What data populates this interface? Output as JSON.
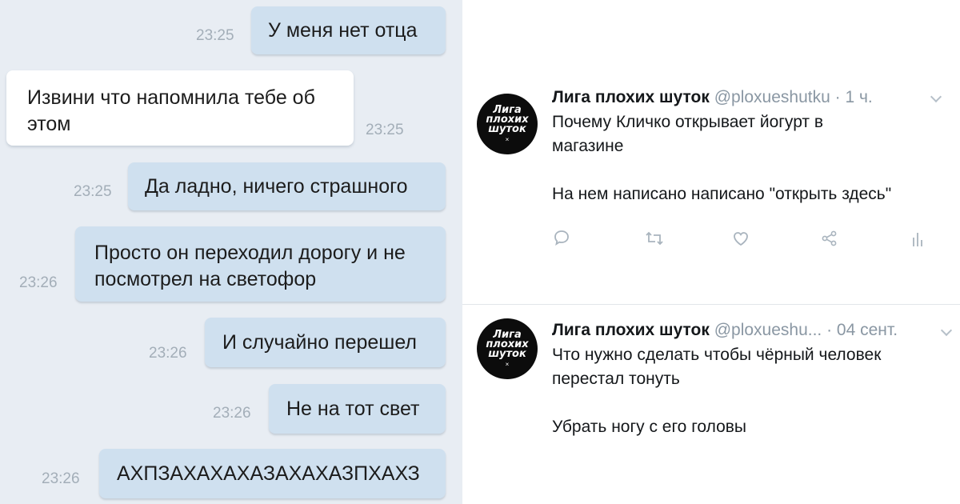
{
  "chat": {
    "messages": [
      {
        "text": "У меня нет отца",
        "time": "23:25",
        "side": "out"
      },
      {
        "line1": "Извини что напомнила тебе об",
        "line2": "этом",
        "time": "23:25",
        "side": "in"
      },
      {
        "text": "Да ладно, ничего страшного",
        "time": "23:25",
        "side": "out"
      },
      {
        "line1": "Просто он переходил дорогу и не",
        "line2": "посмотрел на светофор",
        "time": "23:26",
        "side": "out"
      },
      {
        "text": "И случайно перешел",
        "time": "23:26",
        "side": "out"
      },
      {
        "text": "Не на тот свет",
        "time": "23:26",
        "side": "out"
      },
      {
        "text": "АХПЗАХАХАХАЗАХАХАЗПХАХЗ",
        "time": "23:26",
        "side": "out"
      }
    ]
  },
  "tweets": [
    {
      "avatar_lines": [
        "Лига",
        "плохих",
        "шуток"
      ],
      "avatar_mark": "×",
      "name": "Лига плохих шуток",
      "handle": "@ploxueshutku",
      "time": "· 1 ч.",
      "text": "Почему Кличко открывает йогурт в\nмагазине\n\nНа нем написано написано  \"открыть здесь\"",
      "actions": [
        "reply-icon",
        "retweet-icon",
        "like-icon",
        "share-icon",
        "analytics-icon"
      ]
    },
    {
      "avatar_lines": [
        "Лига",
        "плохих",
        "шуток"
      ],
      "avatar_mark": "×",
      "name": "Лига плохих шуток",
      "handle": "@ploxueshu...",
      "time": "· 04 сент.",
      "text": "Что нужно сделать чтобы чёрный человек\nперестал тонуть\n\nУбрать ногу с его головы"
    }
  ],
  "colors": {
    "chat_bg": "#e8edf3",
    "bubble_out": "#cfe0ef",
    "bubble_in": "#ffffff",
    "timestamp": "#a3aeb8",
    "tweet_secondary": "#8a97a3"
  }
}
